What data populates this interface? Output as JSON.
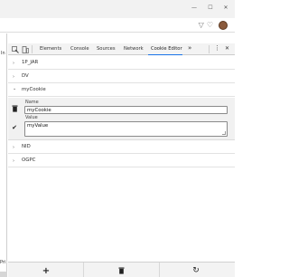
{
  "window": {
    "minimize_glyph": "—",
    "maximize_glyph": "☐",
    "close_glyph": "✕"
  },
  "omnibar": {
    "icon_glyphs": [
      "▽",
      "♡"
    ]
  },
  "page": {
    "top_text": "In",
    "bottom_text": "Pri"
  },
  "devtools": {
    "tabs": [
      "Elements",
      "Console",
      "Sources",
      "Network",
      "Cookie Editor"
    ],
    "active_tab": "Cookie Editor",
    "more_tabs_glyph": "»",
    "menu_glyph": "⋮",
    "close_glyph": "✕"
  },
  "cookies": [
    {
      "name": "1P_JAR",
      "expanded": false
    },
    {
      "name": "DV",
      "expanded": false
    },
    {
      "name": "myCookie",
      "expanded": true
    },
    {
      "name": "NID",
      "expanded": false
    },
    {
      "name": "OGPC",
      "expanded": false
    }
  ],
  "editor": {
    "name_label": "Name",
    "name_value": "myCookie",
    "value_label": "Value",
    "value_value": "myValue"
  },
  "icons": {
    "delete_glyph": "🗑",
    "save_glyph": "✔",
    "add_glyph": "+",
    "delete_all_glyph": "🗑",
    "refresh_glyph": "↻",
    "chevron_closed": "›",
    "chevron_open": "⌄"
  },
  "colors": {
    "accent": "#1a73e8",
    "chrome_bg": "#f2f2f2",
    "toolbar_bg": "#f3f3f3",
    "expanded_bg": "#f1f1f1"
  }
}
